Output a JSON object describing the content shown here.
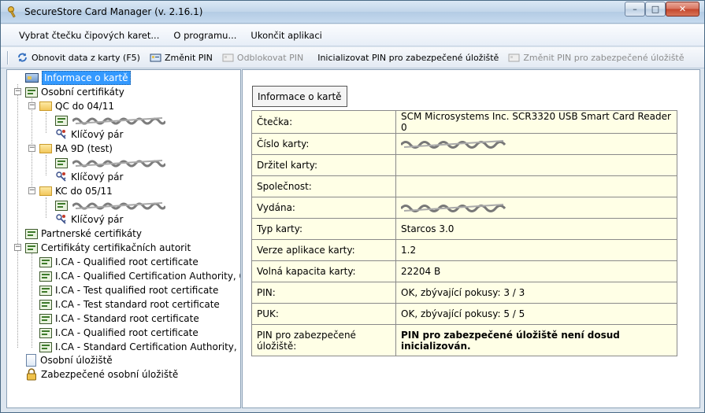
{
  "window": {
    "title": "SecureStore Card Manager (v. 2.16.1)",
    "buttons": {
      "minimize": "–",
      "maximize": "□",
      "close": "✕"
    }
  },
  "menu": {
    "items": [
      "Vybrat čtečku čipových karet...",
      "O programu...",
      "Ukončit aplikaci"
    ]
  },
  "toolbar": {
    "refresh": "Obnovit data z karty (F5)",
    "change_pin": "Změnit PIN",
    "unblock_pin": "Odblokovat PIN",
    "init_pin_secure": "Inicializovat PIN pro zabezpečené úložiště",
    "change_pin_secure": "Změnit PIN pro zabezpečené úložiště"
  },
  "tree": {
    "card_info": "Informace o kartě",
    "personal_certs": "Osobní certifikáty",
    "folder1": "QC do 04/11",
    "folder2": "RA 9D (test)",
    "folder3": "KC do 05/11",
    "key_pair": "Klíčový pár",
    "partner_certs": "Partnerské certifikáty",
    "ca_certs": "Certifikáty certifikačních autorit",
    "ca_items": [
      "I.CA - Qualified root certificate",
      "I.CA - Qualified Certification Authority, 09",
      "I.CA - Test qualified root certificate",
      "I.CA - Test standard root certificate",
      "I.CA - Standard root certificate",
      "I.CA - Qualified root certificate",
      "I.CA - Standard Certification Authority, 09"
    ],
    "personal_storage": "Osobní úložiště",
    "secure_storage": "Zabezpečené osobní úložiště"
  },
  "content": {
    "header": "Informace o kartě",
    "rows": [
      {
        "key": "Čtečka:",
        "value": "SCM Microsystems Inc. SCR3320 USB Smart Card Reader 0"
      },
      {
        "key": "Číslo karty:",
        "value": ""
      },
      {
        "key": "Držitel karty:",
        "value": ""
      },
      {
        "key": "Společnost:",
        "value": ""
      },
      {
        "key": "Vydána:",
        "value": ""
      },
      {
        "key": "Typ karty:",
        "value": "Starcos 3.0"
      },
      {
        "key": "Verze aplikace karty:",
        "value": "1.2"
      },
      {
        "key": "Volná kapacita karty:",
        "value": "22204 B"
      },
      {
        "key": "PIN:",
        "value": "OK, zbývající pokusy: 3 / 3"
      },
      {
        "key": "PUK:",
        "value": "OK, zbývající pokusy: 5 / 5"
      },
      {
        "key": "PIN pro zabezpečené úložiště:",
        "value": "PIN pro zabezpečené úložiště není dosud inicializován."
      }
    ]
  }
}
